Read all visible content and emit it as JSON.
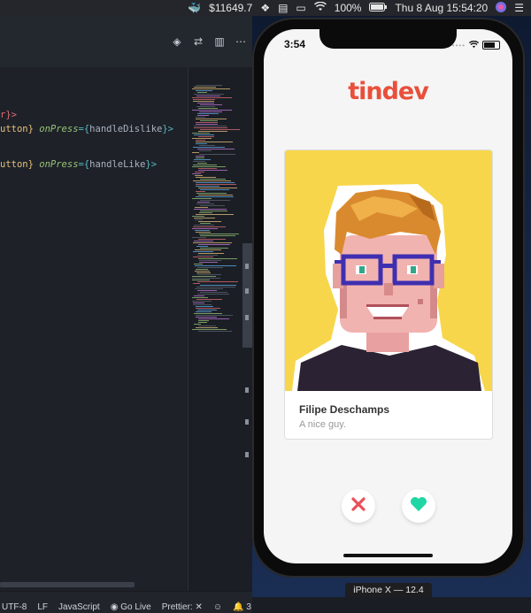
{
  "menubar": {
    "price": "$11649.7",
    "battery": "100%",
    "datetime": "Thu 8 Aug  15:54:20"
  },
  "editor": {
    "code_lines": [
      {
        "a": "r}>",
        "b": "",
        "c": "",
        "d": ""
      },
      {
        "a": "utton}",
        "b": " onPress",
        "c": "={",
        "d": "handleDislike",
        "e": "}>"
      },
      {
        "a": "utton}",
        "b": " onPress",
        "c": "={",
        "d": "handleLike",
        "e": "}>"
      }
    ],
    "status": {
      "encoding": "UTF-8",
      "eol": "LF",
      "language": "JavaScript",
      "golive": "Go Live",
      "prettier": "Prettier: ✕",
      "bell_count": "3"
    }
  },
  "phone": {
    "time": "3:54",
    "logo": "tindev",
    "card": {
      "name": "Filipe Deschamps",
      "bio": "A nice guy."
    },
    "sim_label": "iPhone X — 12.4"
  },
  "colors": {
    "logo": "#e94f3b",
    "dislike": "#e94f5a",
    "like": "#20d6a4",
    "card_bg": "#f7d64b"
  }
}
